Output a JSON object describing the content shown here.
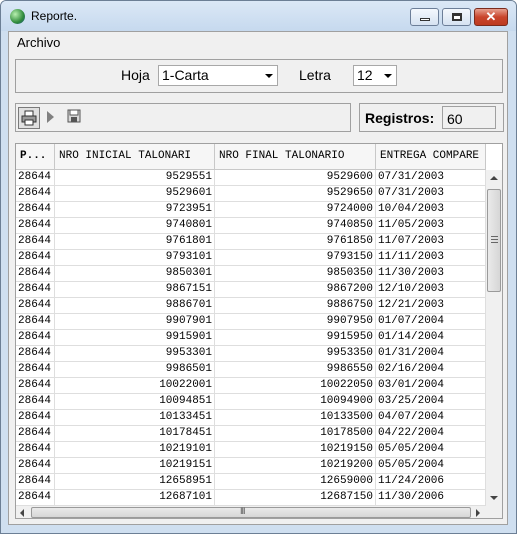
{
  "window": {
    "title": "Reporte."
  },
  "menu": {
    "archivo": "Archivo"
  },
  "params": {
    "hoja_label": "Hoja",
    "hoja_value": "1-Carta",
    "letra_label": "Letra",
    "letra_value": "12"
  },
  "toolbar": {
    "icons": [
      "printer-icon",
      "play-icon",
      "save-icon"
    ]
  },
  "registros": {
    "label": "Registros:",
    "value": "60"
  },
  "grid": {
    "columns": [
      "P...",
      "NRO INICIAL TALONARI",
      "NRO FINAL TALONARIO",
      "ENTREGA COMPARE"
    ],
    "rows": [
      [
        "28644",
        "9529551",
        "9529600",
        "07/31/2003"
      ],
      [
        "28644",
        "9529601",
        "9529650",
        "07/31/2003"
      ],
      [
        "28644",
        "9723951",
        "9724000",
        "10/04/2003"
      ],
      [
        "28644",
        "9740801",
        "9740850",
        "11/05/2003"
      ],
      [
        "28644",
        "9761801",
        "9761850",
        "11/07/2003"
      ],
      [
        "28644",
        "9793101",
        "9793150",
        "11/11/2003"
      ],
      [
        "28644",
        "9850301",
        "9850350",
        "11/30/2003"
      ],
      [
        "28644",
        "9867151",
        "9867200",
        "12/10/2003"
      ],
      [
        "28644",
        "9886701",
        "9886750",
        "12/21/2003"
      ],
      [
        "28644",
        "9907901",
        "9907950",
        "01/07/2004"
      ],
      [
        "28644",
        "9915901",
        "9915950",
        "01/14/2004"
      ],
      [
        "28644",
        "9953301",
        "9953350",
        "01/31/2004"
      ],
      [
        "28644",
        "9986501",
        "9986550",
        "02/16/2004"
      ],
      [
        "28644",
        "10022001",
        "10022050",
        "03/01/2004"
      ],
      [
        "28644",
        "10094851",
        "10094900",
        "03/25/2004"
      ],
      [
        "28644",
        "10133451",
        "10133500",
        "04/07/2004"
      ],
      [
        "28644",
        "10178451",
        "10178500",
        "04/22/2004"
      ],
      [
        "28644",
        "10219101",
        "10219150",
        "05/05/2004"
      ],
      [
        "28644",
        "10219151",
        "10219200",
        "05/05/2004"
      ],
      [
        "28644",
        "12658951",
        "12659000",
        "11/24/2006"
      ],
      [
        "28644",
        "12687101",
        "12687150",
        "11/30/2006"
      ]
    ]
  },
  "scrollbar": {
    "grip": "III"
  }
}
